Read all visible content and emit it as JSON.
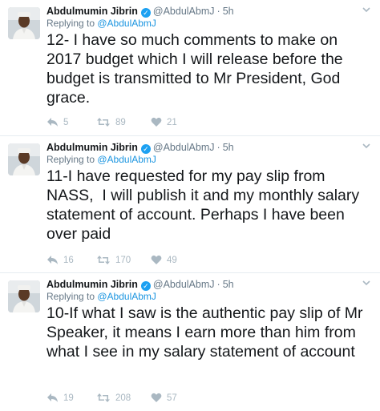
{
  "tweets": [
    {
      "author_name": "Abdulmumin Jibrin",
      "handle": "@AbdulAbmJ",
      "separator": "·",
      "time": "5h",
      "replying_prefix": "Replying to ",
      "replying_handle": "@AbdulAbmJ",
      "text": "12- I have so much comments to make on 2017 budget which I will release before the budget is transmitted to Mr President, God grace.",
      "replies": "5",
      "retweets": "89",
      "likes": "21"
    },
    {
      "author_name": "Abdulmumin Jibrin",
      "handle": "@AbdulAbmJ",
      "separator": "·",
      "time": "5h",
      "replying_prefix": "Replying to ",
      "replying_handle": "@AbdulAbmJ",
      "text": "11-I have requested for my pay slip from NASS,  I will publish it and my monthly salary statement of account. Perhaps I have been over paid",
      "replies": "16",
      "retweets": "170",
      "likes": "49"
    },
    {
      "author_name": "Abdulmumin Jibrin",
      "handle": "@AbdulAbmJ",
      "separator": "·",
      "time": "5h",
      "replying_prefix": "Replying to ",
      "replying_handle": "@AbdulAbmJ",
      "text": "10-If what I saw is the authentic pay slip of Mr Speaker, it means I earn more than him from what I see in my salary statement of account",
      "replies": "19",
      "retweets": "208",
      "likes": "57"
    }
  ],
  "colors": {
    "verified": "#1da1f2",
    "link": "#1b95e0",
    "muted": "#657786",
    "icon": "#aab8c2"
  },
  "icons": {
    "reply": "reply-icon",
    "retweet": "retweet-icon",
    "like": "heart-icon",
    "verified": "verified-badge-icon",
    "more": "chevron-down-icon"
  }
}
